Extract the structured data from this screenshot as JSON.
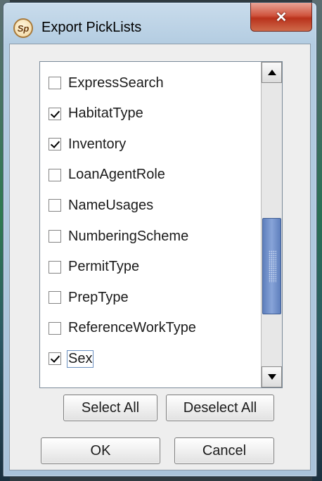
{
  "window": {
    "title": "Export PickLists",
    "app_icon_text": "Sp",
    "close_symbol": "✕"
  },
  "picklists": {
    "items": [
      {
        "label": "ExpressSearch",
        "checked": false
      },
      {
        "label": "HabitatType",
        "checked": true
      },
      {
        "label": "Inventory",
        "checked": true
      },
      {
        "label": "LoanAgentRole",
        "checked": false
      },
      {
        "label": "NameUsages",
        "checked": false
      },
      {
        "label": "NumberingScheme",
        "checked": false
      },
      {
        "label": "PermitType",
        "checked": false
      },
      {
        "label": "PrepType",
        "checked": false
      },
      {
        "label": "ReferenceWorkType",
        "checked": false
      },
      {
        "label": "Sex",
        "checked": true,
        "focused": true
      }
    ],
    "scroll_position": 0.72,
    "visible_fraction": 0.34
  },
  "buttons": {
    "select_all": "Select All",
    "deselect_all": "Deselect All",
    "ok": "OK",
    "cancel": "Cancel"
  },
  "colors": {
    "scroll_thumb": "#6f8fcb",
    "close_button": "#c9452e"
  }
}
